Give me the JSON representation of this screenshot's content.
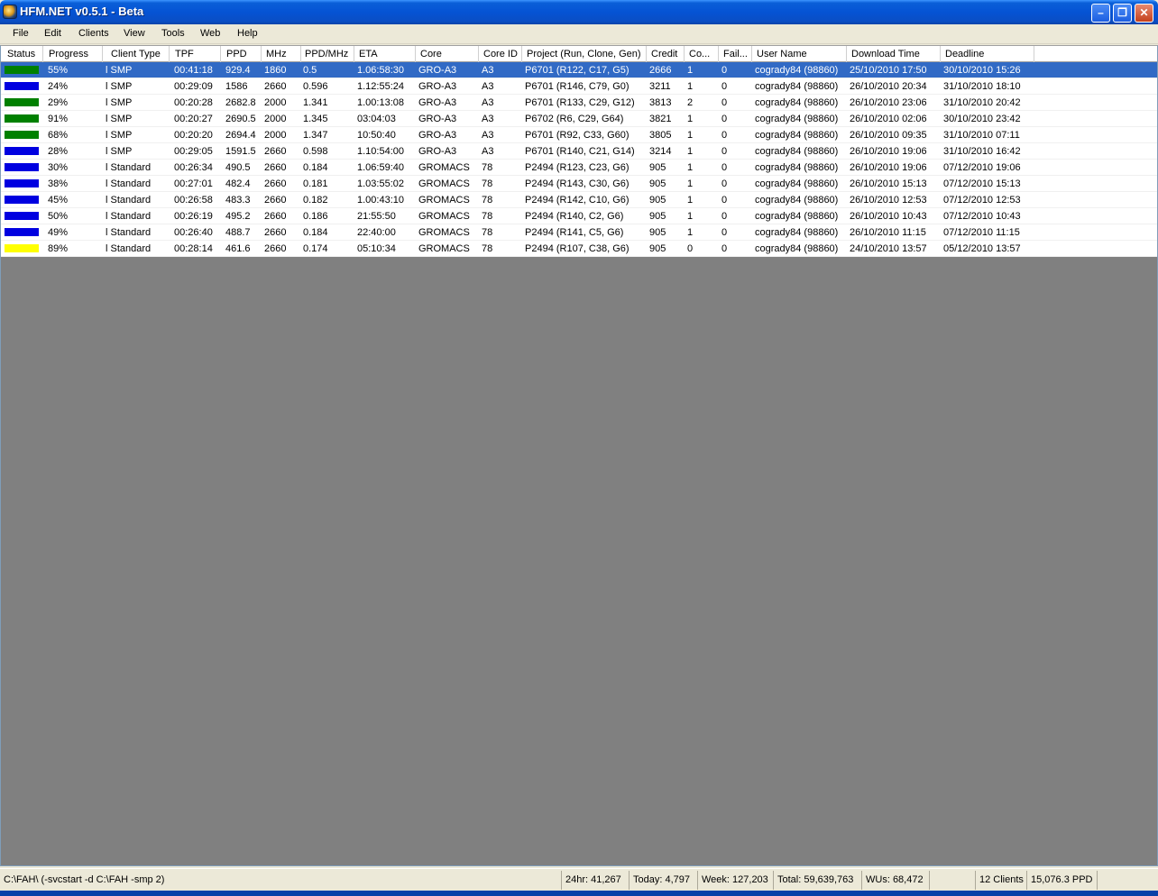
{
  "window": {
    "title": "HFM.NET v0.5.1 - Beta"
  },
  "menu": [
    "File",
    "Edit",
    "Clients",
    "View",
    "Tools",
    "Web",
    "Help"
  ],
  "columns": [
    "Status",
    "Progress",
    "Client Type",
    "TPF",
    "PPD",
    "MHz",
    "PPD/MHz",
    "ETA",
    "Core",
    "Core ID",
    "Project (Run, Clone, Gen)",
    "Credit",
    "Co...",
    "Fail...",
    "User Name",
    "Download Time",
    "Deadline"
  ],
  "status_colors": {
    "green": "#008000",
    "blue": "#0000e0",
    "yellow": "#ffff00"
  },
  "rows": [
    {
      "status": "green",
      "progress": "55%",
      "client_type": "l SMP",
      "tpf": "00:41:18",
      "ppd": "929.4",
      "mhz": "1860",
      "ppd_mhz": "0.5",
      "eta": "1.06:58:30",
      "core": "GRO-A3",
      "core_id": "A3",
      "project": "P6701 (R122, C17, G5)",
      "credit": "2666",
      "completed": "1",
      "failed": "0",
      "user": "cogrady84 (98860)",
      "download": "25/10/2010 17:50",
      "deadline": "30/10/2010 15:26",
      "selected": true
    },
    {
      "status": "blue",
      "progress": "24%",
      "client_type": "l SMP",
      "tpf": "00:29:09",
      "ppd": "1586",
      "mhz": "2660",
      "ppd_mhz": "0.596",
      "eta": "1.12:55:24",
      "core": "GRO-A3",
      "core_id": "A3",
      "project": "P6701 (R146, C79, G0)",
      "credit": "3211",
      "completed": "1",
      "failed": "0",
      "user": "cogrady84 (98860)",
      "download": "26/10/2010 20:34",
      "deadline": "31/10/2010 18:10"
    },
    {
      "status": "green",
      "progress": "29%",
      "client_type": "l SMP",
      "tpf": "00:20:28",
      "ppd": "2682.8",
      "mhz": "2000",
      "ppd_mhz": "1.341",
      "eta": "1.00:13:08",
      "core": "GRO-A3",
      "core_id": "A3",
      "project": "P6701 (R133, C29, G12)",
      "credit": "3813",
      "completed": "2",
      "failed": "0",
      "user": "cogrady84 (98860)",
      "download": "26/10/2010 23:06",
      "deadline": "31/10/2010 20:42"
    },
    {
      "status": "green",
      "progress": "91%",
      "client_type": "l SMP",
      "tpf": "00:20:27",
      "ppd": "2690.5",
      "mhz": "2000",
      "ppd_mhz": "1.345",
      "eta": "03:04:03",
      "core": "GRO-A3",
      "core_id": "A3",
      "project": "P6702 (R6, C29, G64)",
      "credit": "3821",
      "completed": "1",
      "failed": "0",
      "user": "cogrady84 (98860)",
      "download": "26/10/2010 02:06",
      "deadline": "30/10/2010 23:42"
    },
    {
      "status": "green",
      "progress": "68%",
      "client_type": "l SMP",
      "tpf": "00:20:20",
      "ppd": "2694.4",
      "mhz": "2000",
      "ppd_mhz": "1.347",
      "eta": "10:50:40",
      "core": "GRO-A3",
      "core_id": "A3",
      "project": "P6701 (R92, C33, G60)",
      "credit": "3805",
      "completed": "1",
      "failed": "0",
      "user": "cogrady84 (98860)",
      "download": "26/10/2010 09:35",
      "deadline": "31/10/2010 07:11"
    },
    {
      "status": "blue",
      "progress": "28%",
      "client_type": "l SMP",
      "tpf": "00:29:05",
      "ppd": "1591.5",
      "mhz": "2660",
      "ppd_mhz": "0.598",
      "eta": "1.10:54:00",
      "core": "GRO-A3",
      "core_id": "A3",
      "project": "P6701 (R140, C21, G14)",
      "credit": "3214",
      "completed": "1",
      "failed": "0",
      "user": "cogrady84 (98860)",
      "download": "26/10/2010 19:06",
      "deadline": "31/10/2010 16:42"
    },
    {
      "status": "blue",
      "progress": "30%",
      "client_type": "l Standard",
      "tpf": "00:26:34",
      "ppd": "490.5",
      "mhz": "2660",
      "ppd_mhz": "0.184",
      "eta": "1.06:59:40",
      "core": "GROMACS",
      "core_id": "78",
      "project": "P2494 (R123, C23, G6)",
      "credit": "905",
      "completed": "1",
      "failed": "0",
      "user": "cogrady84 (98860)",
      "download": "26/10/2010 19:06",
      "deadline": "07/12/2010 19:06"
    },
    {
      "status": "blue",
      "progress": "38%",
      "client_type": "l Standard",
      "tpf": "00:27:01",
      "ppd": "482.4",
      "mhz": "2660",
      "ppd_mhz": "0.181",
      "eta": "1.03:55:02",
      "core": "GROMACS",
      "core_id": "78",
      "project": "P2494 (R143, C30, G6)",
      "credit": "905",
      "completed": "1",
      "failed": "0",
      "user": "cogrady84 (98860)",
      "download": "26/10/2010 15:13",
      "deadline": "07/12/2010 15:13"
    },
    {
      "status": "blue",
      "progress": "45%",
      "client_type": "l Standard",
      "tpf": "00:26:58",
      "ppd": "483.3",
      "mhz": "2660",
      "ppd_mhz": "0.182",
      "eta": "1.00:43:10",
      "core": "GROMACS",
      "core_id": "78",
      "project": "P2494 (R142, C10, G6)",
      "credit": "905",
      "completed": "1",
      "failed": "0",
      "user": "cogrady84 (98860)",
      "download": "26/10/2010 12:53",
      "deadline": "07/12/2010 12:53"
    },
    {
      "status": "blue",
      "progress": "50%",
      "client_type": "l Standard",
      "tpf": "00:26:19",
      "ppd": "495.2",
      "mhz": "2660",
      "ppd_mhz": "0.186",
      "eta": "21:55:50",
      "core": "GROMACS",
      "core_id": "78",
      "project": "P2494 (R140, C2, G6)",
      "credit": "905",
      "completed": "1",
      "failed": "0",
      "user": "cogrady84 (98860)",
      "download": "26/10/2010 10:43",
      "deadline": "07/12/2010 10:43"
    },
    {
      "status": "blue",
      "progress": "49%",
      "client_type": "l Standard",
      "tpf": "00:26:40",
      "ppd": "488.7",
      "mhz": "2660",
      "ppd_mhz": "0.184",
      "eta": "22:40:00",
      "core": "GROMACS",
      "core_id": "78",
      "project": "P2494 (R141, C5, G6)",
      "credit": "905",
      "completed": "1",
      "failed": "0",
      "user": "cogrady84 (98860)",
      "download": "26/10/2010 11:15",
      "deadline": "07/12/2010 11:15"
    },
    {
      "status": "yellow",
      "progress": "89%",
      "client_type": "l Standard",
      "tpf": "00:28:14",
      "ppd": "461.6",
      "mhz": "2660",
      "ppd_mhz": "0.174",
      "eta": "05:10:34",
      "core": "GROMACS",
      "core_id": "78",
      "project": "P2494 (R107, C38, G6)",
      "credit": "905",
      "completed": "0",
      "failed": "0",
      "user": "cogrady84 (98860)",
      "download": "24/10/2010 13:57",
      "deadline": "05/12/2010 13:57"
    }
  ],
  "statusbar": {
    "path": "C:\\FAH\\ (-svcstart -d C:\\FAH -smp 2)",
    "day24": "24hr: 41,267",
    "today": "Today: 4,797",
    "week": "Week: 127,203",
    "total": "Total: 59,639,763",
    "wus": "WUs: 68,472",
    "clients": "12 Clients",
    "ppd": "15,076.3 PPD"
  }
}
